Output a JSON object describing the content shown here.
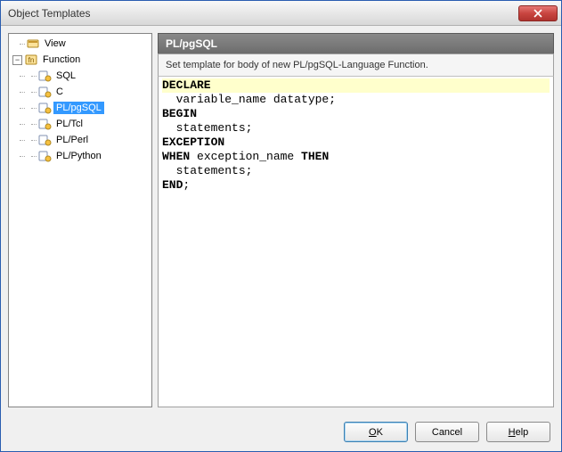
{
  "window": {
    "title": "Object Templates"
  },
  "tree": {
    "view": {
      "label": "View",
      "icon": "view-icon"
    },
    "function": {
      "label": "Function",
      "icon": "function-icon"
    },
    "items": [
      {
        "label": "SQL",
        "selected": false
      },
      {
        "label": "C",
        "selected": false
      },
      {
        "label": "PL/pgSQL",
        "selected": true
      },
      {
        "label": "PL/Tcl",
        "selected": false
      },
      {
        "label": "PL/Perl",
        "selected": false
      },
      {
        "label": "PL/Python",
        "selected": false
      }
    ]
  },
  "panel": {
    "header": "PL/pgSQL",
    "description": "Set template for body of new PL/pgSQL-Language Function."
  },
  "editor": {
    "highlight_line_index": 0,
    "lines": [
      "DECLARE",
      "  variable_name datatype;",
      "BEGIN",
      "  statements;",
      "EXCEPTION",
      "WHEN exception_name THEN",
      "  statements;",
      "END;"
    ]
  },
  "buttons": {
    "ok": "OK",
    "cancel": "Cancel",
    "help": "Help"
  },
  "colors": {
    "selection": "#3399ff",
    "highlight_line": "#ffffcc"
  }
}
